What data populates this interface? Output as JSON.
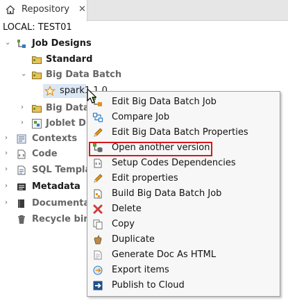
{
  "tab": {
    "label": "Repository",
    "close": "✕"
  },
  "connection": "LOCAL: TEST01",
  "tree": {
    "job_designs": "Job Designs",
    "standard": "Standard",
    "big_data_batch": "Big Data Batch",
    "spark1": "spark1 1.0",
    "big_data_streaming": "Big Data",
    "joblet": "Joblet D",
    "contexts": "Contexts",
    "code": "Code",
    "sql_templates": "SQL Templa",
    "metadata": "Metadata",
    "documentation": "Documenta",
    "recycle_bin": "Recycle bin"
  },
  "menu": {
    "items": [
      {
        "label": "Edit Big Data Batch Job"
      },
      {
        "label": "Compare Job"
      },
      {
        "label": "Edit Big Data Batch Properties"
      },
      {
        "label": "Open another version"
      },
      {
        "label": "Setup Codes Dependencies"
      },
      {
        "label": "Edit properties"
      },
      {
        "label": "Build Big Data Batch Job"
      },
      {
        "label": "Delete"
      },
      {
        "label": "Copy"
      },
      {
        "label": "Duplicate"
      },
      {
        "label": "Generate Doc As HTML"
      },
      {
        "label": "Export items"
      },
      {
        "label": "Publish to Cloud"
      }
    ],
    "highlighted_item": "Open another version",
    "highlight_color": "#d9161c"
  },
  "colors": {
    "selection": "#dbe7f5",
    "menu_bg": "#f7f7f7",
    "tab_bar_bg": "#e6e6e6"
  }
}
